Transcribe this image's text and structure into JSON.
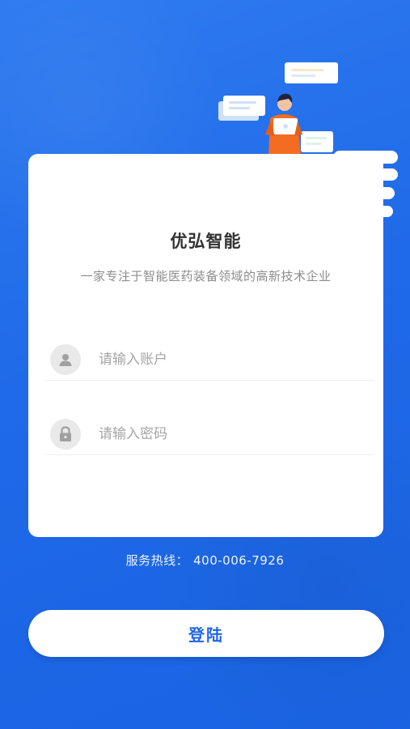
{
  "app": {
    "title": "优弘智能",
    "subtitle": "一家专注于智能医药装备领域的高新技术企业"
  },
  "form": {
    "account_placeholder": "请输入账户",
    "account_value": "",
    "password_placeholder": "请输入密码",
    "password_value": ""
  },
  "hotline": {
    "label": "服务热线：",
    "number": "400-006-7926"
  },
  "login": {
    "label": "登陆"
  },
  "icons": {
    "account": "user-icon",
    "password": "lock-icon"
  },
  "colors": {
    "background": "#1f6ae8",
    "button_text": "#1f66e6",
    "card": "#ffffff",
    "person_shirt": "#f36c21"
  }
}
